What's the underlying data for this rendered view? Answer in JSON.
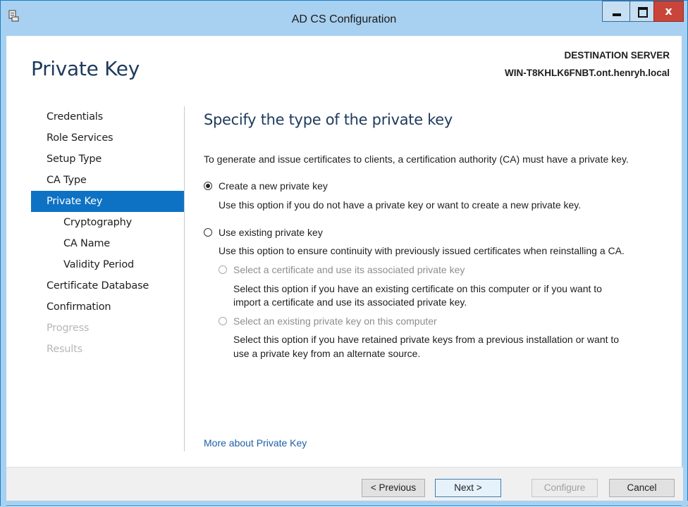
{
  "window": {
    "title": "AD CS Configuration"
  },
  "header": {
    "page_title": "Private Key",
    "destination_label": "DESTINATION SERVER",
    "destination_server": "WIN-T8KHLK6FNBT.ont.henryh.local"
  },
  "nav": {
    "items": [
      {
        "label": "Credentials"
      },
      {
        "label": "Role Services"
      },
      {
        "label": "Setup Type"
      },
      {
        "label": "CA Type"
      },
      {
        "label": "Private Key"
      },
      {
        "label": "Cryptography"
      },
      {
        "label": "CA Name"
      },
      {
        "label": "Validity Period"
      },
      {
        "label": "Certificate Database"
      },
      {
        "label": "Confirmation"
      },
      {
        "label": "Progress"
      },
      {
        "label": "Results"
      }
    ],
    "active": "Private Key"
  },
  "content": {
    "section_title": "Specify the type of the private key",
    "intro": "To generate and issue certificates to clients, a certification authority (CA) must have a private key.",
    "options": {
      "create_new": {
        "label": "Create a new private key",
        "desc": "Use this option if you do not have a private key or want to create a new private key.",
        "selected": true
      },
      "use_existing": {
        "label": "Use existing private key",
        "desc": "Use this option to ensure continuity with previously issued certificates when reinstalling a CA.",
        "selected": false
      },
      "select_certificate": {
        "label": "Select a certificate and use its associated private key",
        "desc_line1": "Select this option if you have an existing certificate on this computer or if you want to",
        "desc_line2": "import a certificate and use its associated private key."
      },
      "select_existing_key": {
        "label": "Select an existing private key on this computer",
        "desc_line1": "Select this option if you have retained private keys from a previous installation or want to",
        "desc_line2": "use a private key from an alternate source."
      }
    },
    "more_link": "More about Private Key"
  },
  "footer": {
    "previous": "< Previous",
    "next": "Next >",
    "configure": "Configure",
    "cancel": "Cancel"
  },
  "colors": {
    "titlebar": "#a8d0f0",
    "accent": "#0e72c4",
    "link": "#1e5fa6"
  }
}
